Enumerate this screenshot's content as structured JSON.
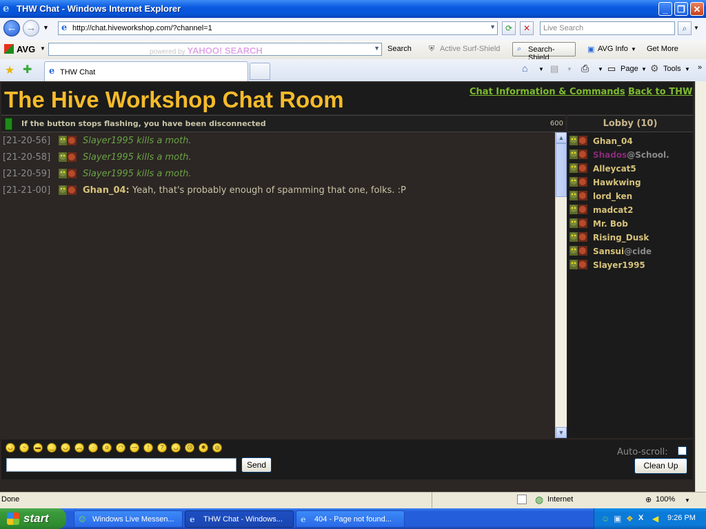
{
  "window": {
    "title": "THW Chat - Windows Internet Explorer"
  },
  "address_bar": {
    "url": "http://chat.hiveworkshop.com/?channel=1",
    "live_search_placeholder": "Live Search"
  },
  "avg_toolbar": {
    "brand": "AVG",
    "search_powered": "powered by",
    "search_brand": "YAHOO! SEARCH",
    "search_label": "Search",
    "active_surf_shield": "Active  Surf-Shield",
    "search_shield": "Search-Shield",
    "avg_info": "AVG Info",
    "get_more": "Get More"
  },
  "tabs": {
    "active_tab": "THW Chat",
    "page_menu": "Page",
    "tools_menu": "Tools"
  },
  "chat": {
    "title": "The Hive Workshop Chat Room",
    "links": [
      "Chat Information & Commands",
      "Back to THW"
    ],
    "status_message": "If the button stops flashing, you have been disconnected",
    "status_counter": "600",
    "messages": [
      {
        "time": "[21-20-56]",
        "nick": "",
        "text": "Slayer1995 kills a moth.",
        "type": "action"
      },
      {
        "time": "[21-20-58]",
        "nick": "",
        "text": "Slayer1995 kills a moth.",
        "type": "action"
      },
      {
        "time": "[21-20-59]",
        "nick": "",
        "text": "Slayer1995 kills a moth.",
        "type": "action"
      },
      {
        "time": "[21-21-00]",
        "nick": "Ghan_04:",
        "text": "Yeah, that's probably enough of spamming that one, folks. :P",
        "type": "say"
      }
    ],
    "lobby": {
      "header": "Lobby (10)",
      "users": [
        {
          "name": "Ghan_04",
          "suffix": "",
          "color": "#d6c27a"
        },
        {
          "name": "Shados",
          "suffix": "@School.",
          "color": "#8a2a78"
        },
        {
          "name": "Alleycat5",
          "suffix": "",
          "color": "#d6c27a"
        },
        {
          "name": "Hawkwing",
          "suffix": "",
          "color": "#d6c27a"
        },
        {
          "name": "lord_ken",
          "suffix": "",
          "color": "#d6c27a"
        },
        {
          "name": "madcat2",
          "suffix": "",
          "color": "#d6c27a"
        },
        {
          "name": "Mr. Bob",
          "suffix": "",
          "color": "#d6c27a"
        },
        {
          "name": "Rising_Dusk",
          "suffix": "",
          "color": "#d6c27a"
        },
        {
          "name": "Sansui",
          "suffix": "@cide",
          "color": "#d6c27a"
        },
        {
          "name": "Slayer1995",
          "suffix": "",
          "color": "#d6c27a"
        }
      ]
    },
    "input_value": "",
    "send_label": "Send",
    "autoscroll_label": "Auto-scroll:",
    "autoscroll_checked": false,
    "cleanup_label": "Clean Up"
  },
  "ie_status": {
    "left": "Done",
    "zone": "Internet",
    "zoom": "100%"
  },
  "taskbar": {
    "start": "start",
    "tasks": [
      {
        "label": "Windows Live Messen...",
        "active": false
      },
      {
        "label": "THW Chat - Windows...",
        "active": true
      },
      {
        "label": "404 - Page not found...",
        "active": false
      }
    ],
    "clock": "9:26 PM"
  },
  "colors": {
    "title_gold": "#f6bb2a",
    "link_green": "#7dba2e",
    "action_green": "#6aa246",
    "nick_gold": "#d6c27a",
    "chat_bg": "#2c2624"
  }
}
